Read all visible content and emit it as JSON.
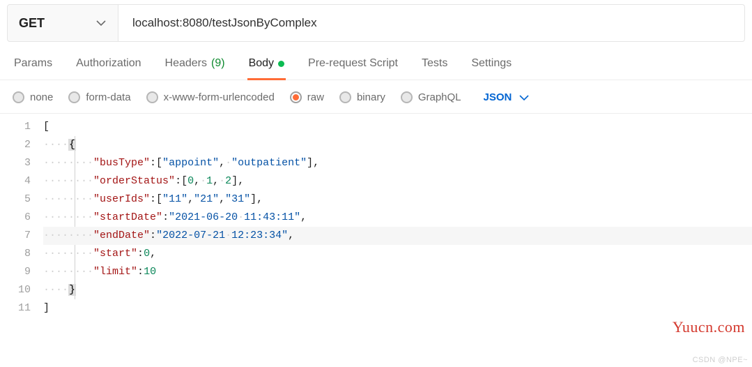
{
  "request": {
    "method": "GET",
    "url": "localhost:8080/testJsonByComplex"
  },
  "tabs": {
    "params": "Params",
    "authorization": "Authorization",
    "headers": "Headers",
    "headers_count": "(9)",
    "body": "Body",
    "pre_request": "Pre-request Script",
    "tests": "Tests",
    "settings": "Settings"
  },
  "body_types": {
    "none": "none",
    "form_data": "form-data",
    "urlencoded": "x-www-form-urlencoded",
    "raw": "raw",
    "binary": "binary",
    "graphql": "GraphQL",
    "lang": "JSON"
  },
  "editor": {
    "line_numbers": [
      "1",
      "2",
      "3",
      "4",
      "5",
      "6",
      "7",
      "8",
      "9",
      "10",
      "11"
    ],
    "body_json": {
      "busType": [
        "appoint",
        "outpatient"
      ],
      "orderStatus": [
        0,
        1,
        2
      ],
      "userIds": [
        "11",
        "21",
        "31"
      ],
      "startDate": "2021-06-20 11:43:11",
      "endDate": "2022-07-21 12:23:34",
      "start": 0,
      "limit": 10
    }
  },
  "watermark1": "Yuucn.com",
  "watermark2": "CSDN @NPE~"
}
